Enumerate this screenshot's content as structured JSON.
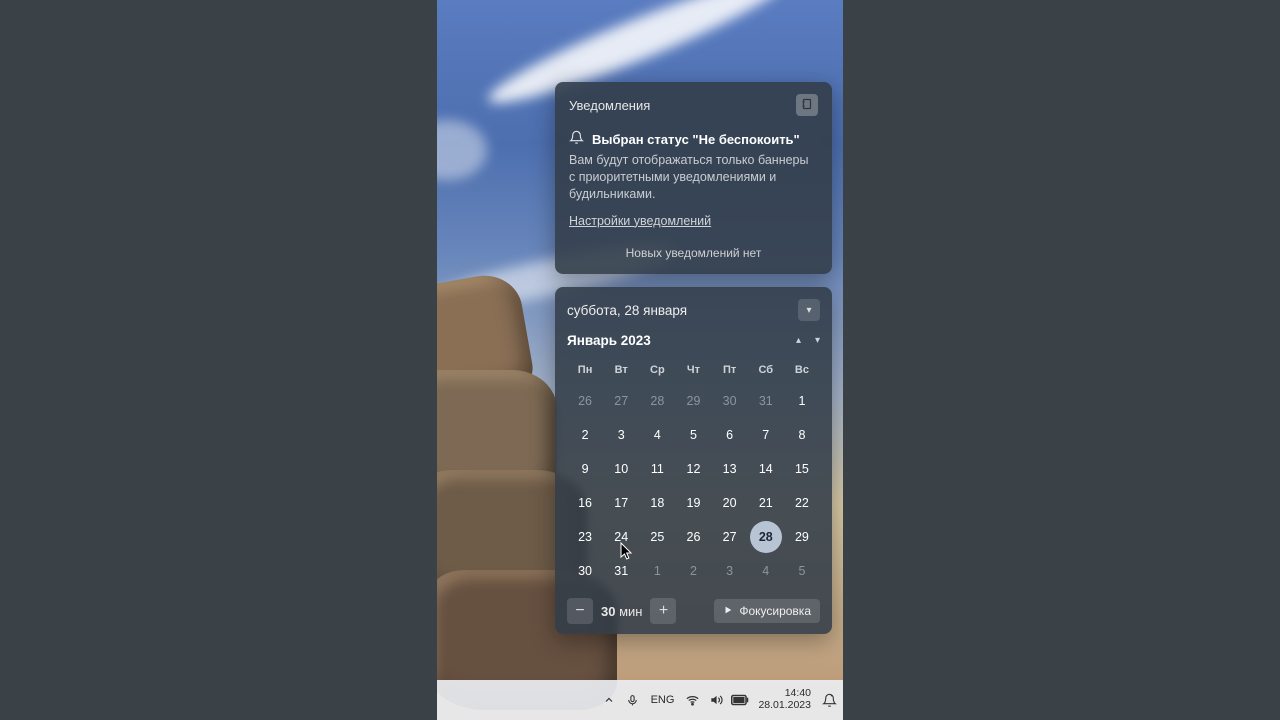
{
  "notifications": {
    "header": "Уведомления",
    "dnd_title": "Выбран статус \"Не беспокоить\"",
    "dnd_body": "Вам будут отображаться только баннеры с приоритетными уведомлениями и будильниками.",
    "settings_link": "Настройки уведомлений",
    "empty": "Новых уведомлений нет"
  },
  "calendar": {
    "today_long": "суббота, 28 января",
    "month_label": "Январь 2023",
    "dow": [
      "Пн",
      "Вт",
      "Ср",
      "Чт",
      "Пт",
      "Сб",
      "Вс"
    ],
    "cells": [
      {
        "n": "26",
        "dim": true
      },
      {
        "n": "27",
        "dim": true
      },
      {
        "n": "28",
        "dim": true
      },
      {
        "n": "29",
        "dim": true
      },
      {
        "n": "30",
        "dim": true
      },
      {
        "n": "31",
        "dim": true
      },
      {
        "n": "1"
      },
      {
        "n": "2"
      },
      {
        "n": "3"
      },
      {
        "n": "4"
      },
      {
        "n": "5"
      },
      {
        "n": "6"
      },
      {
        "n": "7"
      },
      {
        "n": "8"
      },
      {
        "n": "9"
      },
      {
        "n": "10"
      },
      {
        "n": "11"
      },
      {
        "n": "12"
      },
      {
        "n": "13"
      },
      {
        "n": "14"
      },
      {
        "n": "15"
      },
      {
        "n": "16"
      },
      {
        "n": "17"
      },
      {
        "n": "18"
      },
      {
        "n": "19"
      },
      {
        "n": "20"
      },
      {
        "n": "21"
      },
      {
        "n": "22"
      },
      {
        "n": "23"
      },
      {
        "n": "24"
      },
      {
        "n": "25"
      },
      {
        "n": "26"
      },
      {
        "n": "27"
      },
      {
        "n": "28",
        "today": true
      },
      {
        "n": "29"
      },
      {
        "n": "30"
      },
      {
        "n": "31"
      },
      {
        "n": "1",
        "dim": true
      },
      {
        "n": "2",
        "dim": true
      },
      {
        "n": "3",
        "dim": true
      },
      {
        "n": "4",
        "dim": true
      },
      {
        "n": "5",
        "dim": true
      }
    ],
    "focus": {
      "duration_value": "30",
      "duration_unit": "мин",
      "button": "Фокусировка"
    }
  },
  "taskbar": {
    "lang": "ENG",
    "time": "14:40",
    "date": "28.01.2023"
  }
}
